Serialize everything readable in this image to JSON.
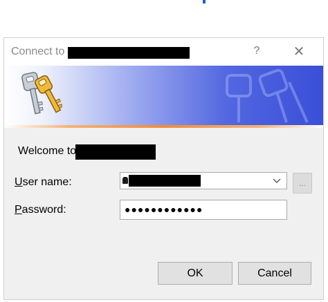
{
  "window": {
    "title": "Connect to",
    "help_icon": "?",
    "close_icon": "✕"
  },
  "banner": {
    "icon": "keys-icon",
    "watermark": "keys-watermark-icon"
  },
  "form": {
    "welcome_text": "Welcome to",
    "username_label_prefix": "U",
    "username_label_rest": "ser name:",
    "password_label_prefix": "P",
    "password_label_rest": "assword:",
    "password_value": "●●●●●●●●●●●●",
    "browse_label": "..."
  },
  "buttons": {
    "ok": "OK",
    "cancel": "Cancel"
  },
  "colors": {
    "banner_blue": "#3a4fd8",
    "accent_orange": "#f08c3a",
    "dialog_bg": "#f0f0f0"
  }
}
